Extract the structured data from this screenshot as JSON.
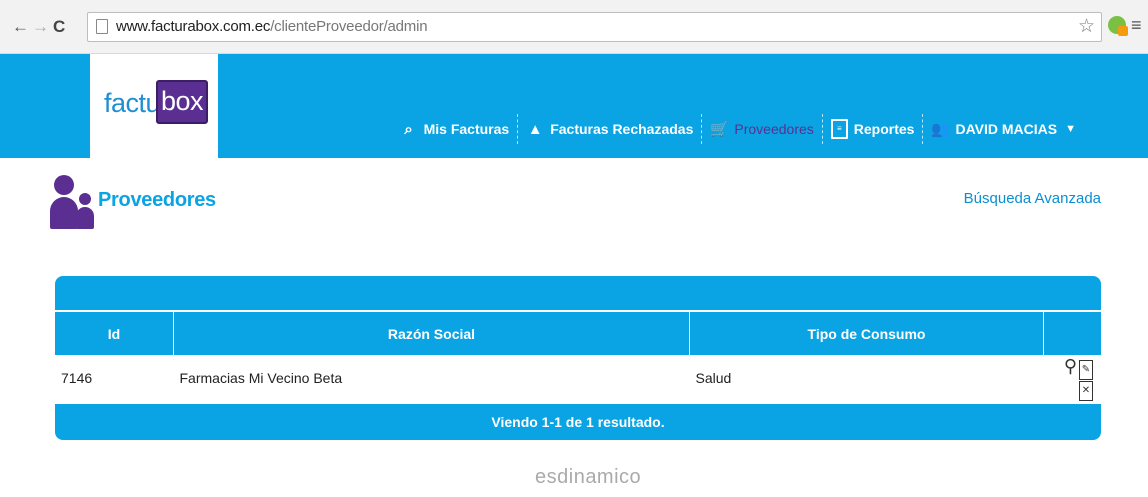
{
  "browser": {
    "back_glyph": "←",
    "forward_glyph": "→",
    "reload_glyph": "C",
    "url_host": "www.facturabox.com.ec",
    "url_path": "/clienteProveedor/admin",
    "star_glyph": "☆",
    "menu_glyph": "≡",
    "icons": [
      "back-icon",
      "forward-icon",
      "reload-icon",
      "page-icon",
      "star-icon",
      "extension-icon",
      "menu-icon"
    ]
  },
  "logo": {
    "part1": "factura",
    "part2": "box"
  },
  "nav": [
    {
      "label": "Mis Facturas",
      "icon": "search-document-icon",
      "glyph": "⌕"
    },
    {
      "label": "Facturas Rechazadas",
      "icon": "warning-icon",
      "glyph": "▲"
    },
    {
      "label": "Proveedores",
      "icon": "cart-icon",
      "glyph": "🛒"
    },
    {
      "label": "Reportes",
      "icon": "report-icon",
      "glyph": "≡"
    },
    {
      "label": "DAVID MACIAS",
      "icon": "users-icon",
      "glyph": "👥",
      "caret": "▼"
    }
  ],
  "page": {
    "title": "Proveedores",
    "advanced_search": "Búsqueda Avanzada"
  },
  "table": {
    "columns": [
      "Id",
      "Razón Social",
      "Tipo de Consumo",
      ""
    ],
    "rows": [
      {
        "id": "7146",
        "razon_social": "Farmacias Mi Vecino Beta",
        "tipo_consumo": "Salud"
      }
    ],
    "action_icons": [
      "view-icon",
      "edit-icon",
      "delete-icon"
    ],
    "footer": "Viendo 1-1 de 1 resultado."
  },
  "credit": "esdinamico",
  "colors": {
    "primary": "#0aa4e4",
    "brand_purple": "#5b2f91"
  }
}
